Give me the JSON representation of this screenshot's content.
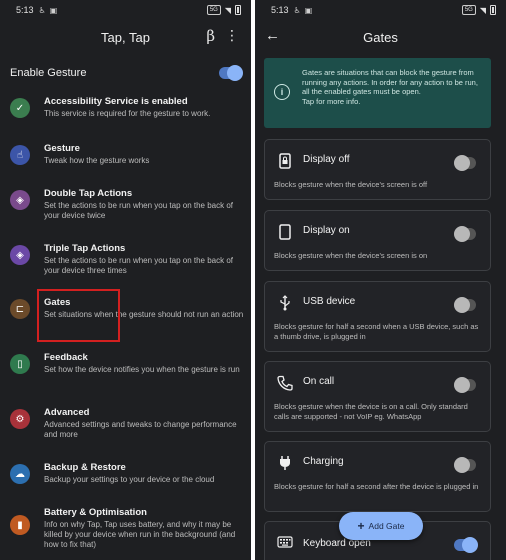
{
  "left": {
    "status": {
      "time": "5:13",
      "icons": [
        "accessibility-icon",
        "image-icon"
      ],
      "sim_badge": "5G"
    },
    "appbar": {
      "title": "Tap, Tap",
      "beta": "β",
      "more": "⋮"
    },
    "enable_gesture": {
      "label": "Enable Gesture",
      "on": true
    },
    "items": [
      {
        "title": "Accessibility Service is enabled",
        "subtitle": "This service is required for the gesture to work.",
        "icon": "check-icon",
        "glyph": "✓",
        "color": "#3b7d4f"
      },
      {
        "title": "Gesture",
        "subtitle": "Tweak how the gesture works",
        "icon": "gesture-hand-icon",
        "glyph": "☝",
        "color": "#3c55a8"
      },
      {
        "title": "Double Tap Actions",
        "subtitle": "Set the actions to be run when you tap on the back of your device twice",
        "icon": "layers-icon",
        "glyph": "◈",
        "color": "#7a4a8c"
      },
      {
        "title": "Triple Tap Actions",
        "subtitle": "Set the actions to be run when you tap on the back of your device three times",
        "icon": "layers-icon",
        "glyph": "◈",
        "color": "#6b48a6"
      },
      {
        "title": "Gates",
        "subtitle": "Set situations when the gesture should not run an action",
        "icon": "gate-icon",
        "glyph": "⊏",
        "color": "#6b4a2a"
      },
      {
        "title": "Feedback",
        "subtitle": "Set how the device notifies you when the gesture is run",
        "icon": "vibration-icon",
        "glyph": "▯",
        "color": "#2f7a4e"
      },
      {
        "title": "Advanced",
        "subtitle": "Advanced settings and tweaks to change performance and more",
        "icon": "settings-icon",
        "glyph": "⚙",
        "color": "#a8323a"
      },
      {
        "title": "Backup & Restore",
        "subtitle": "Backup your settings to your device or the cloud",
        "icon": "cloud-icon",
        "glyph": "☁",
        "color": "#2c6fb0"
      },
      {
        "title": "Battery & Optimisation",
        "subtitle": "Info on why Tap, Tap uses battery, and why it may be killed by your device when run in the background (and how to fix that)",
        "icon": "battery-icon",
        "glyph": "▮",
        "color": "#c05a22"
      }
    ]
  },
  "right": {
    "status": {
      "time": "5:13",
      "icons": [
        "accessibility-icon",
        "image-icon"
      ],
      "sim_badge": "5G"
    },
    "appbar": {
      "title": "Gates",
      "back": "←"
    },
    "info": {
      "text_1": "Gates are situations that can block the gesture from running any actions. In order for any action to be run, all the enabled gates must be open.",
      "text_2": "Tap for more info."
    },
    "gates": [
      {
        "title": "Display off",
        "desc": "Blocks gesture when the device's screen is off",
        "icon": "phone-lock-icon",
        "glyph": "🔒",
        "on": false
      },
      {
        "title": "Display on",
        "desc": "Blocks gesture when the device's screen is on",
        "icon": "phone-icon",
        "glyph": "▯",
        "on": false
      },
      {
        "title": "USB device",
        "desc": "Blocks gesture for half a second when a USB device, such as a thumb drive, is plugged in",
        "icon": "usb-icon",
        "glyph": "⚲",
        "on": false
      },
      {
        "title": "On call",
        "desc": "Blocks gesture when the device is on a call. Only standard calls are supported - not VoIP eg. WhatsApp",
        "icon": "phone-call-icon",
        "glyph": "✆",
        "on": false
      },
      {
        "title": "Charging",
        "desc": "Blocks gesture for half a second after the device is plugged in",
        "icon": "power-plug-icon",
        "glyph": "⏚",
        "on": false
      },
      {
        "title": "Keyboard open",
        "desc": "",
        "icon": "keyboard-icon",
        "glyph": "⌨",
        "on": true
      }
    ],
    "fab": {
      "label": "Add Gate",
      "plus": "+"
    }
  }
}
